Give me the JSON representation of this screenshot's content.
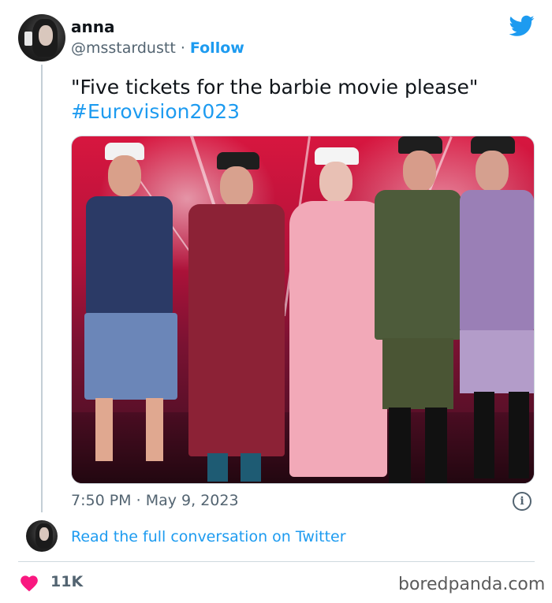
{
  "user": {
    "name": "anna",
    "handle": "@msstardustt",
    "separator": "·",
    "follow_label": "Follow"
  },
  "tweet": {
    "text": "\"Five tickets for the barbie movie please\"",
    "hashtag": "#Eurovision2023",
    "time": "7:50 PM",
    "separator": "·",
    "date": "May 9, 2023"
  },
  "conversation": {
    "link_label": "Read the full conversation on Twitter"
  },
  "engagement": {
    "likes": "11K"
  },
  "watermark": "boredpanda.com",
  "icons": {
    "brand": "twitter-bird-icon",
    "info": "info-icon",
    "like": "heart-icon"
  },
  "colors": {
    "accent": "#1d9bf0",
    "like": "#f91880",
    "secondary_text": "#536471"
  }
}
